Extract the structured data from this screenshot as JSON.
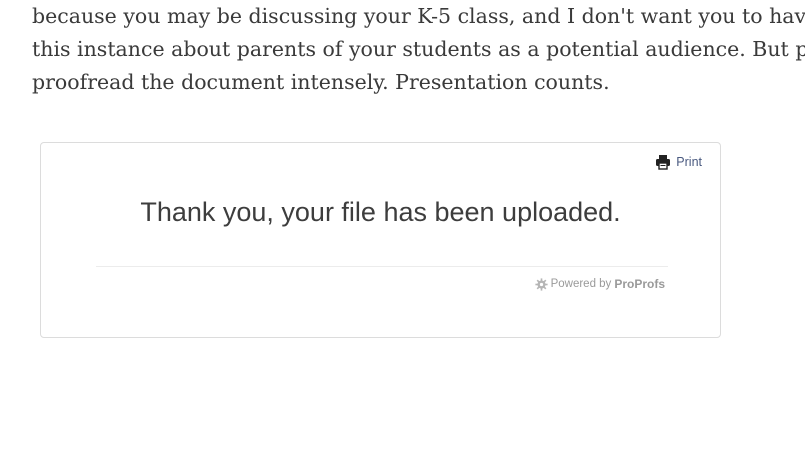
{
  "article": {
    "lines": [
      "because you may be discussing your K-5 class, and I don't want you to have to worry in",
      "this instance about parents of your students as a potential audience. But please",
      "proofread the document intensely. Presentation counts."
    ]
  },
  "upload_widget": {
    "print_label": "Print",
    "print_icon": "printer-icon",
    "confirmation_message": "Thank you, your file has been uploaded.",
    "powered_by_prefix": "Powered by",
    "powered_by_brand": "ProProfs",
    "powered_icon": "gear-icon"
  },
  "colors": {
    "body_text": "#3a3a3a",
    "card_border": "#dcdcdc",
    "print_link": "#4a5a80",
    "muted": "#9a9a9a"
  }
}
